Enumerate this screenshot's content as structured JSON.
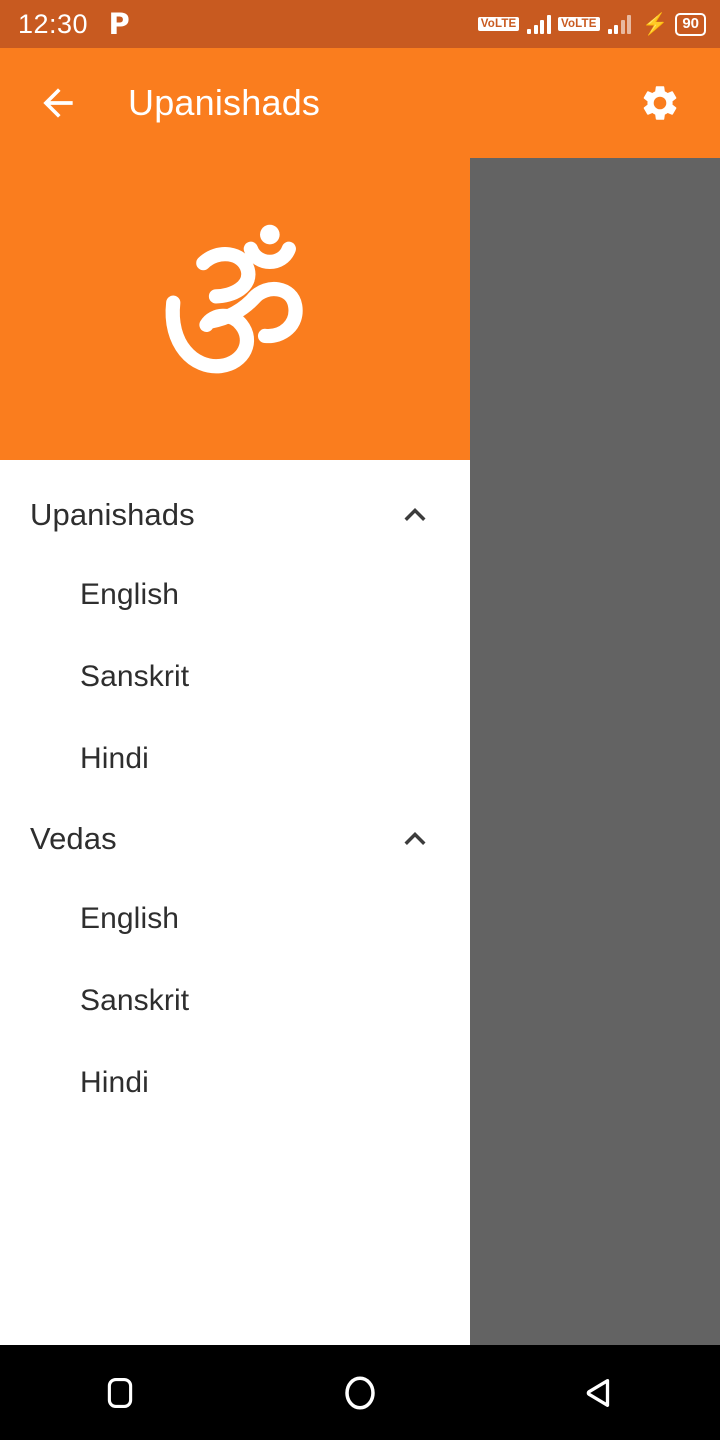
{
  "status_bar": {
    "clock": "12:30",
    "notification_icon": "p-app-icon",
    "sim1_network": "VoLTE",
    "sim2_network": "VoLTE",
    "charging_icon": "charging-bolt-icon",
    "battery_level": "90",
    "background_color": "#c85a20"
  },
  "app_bar": {
    "back_icon": "back-arrow-icon",
    "title": "Upanishads",
    "settings_icon": "gear-icon",
    "background_color": "#fa7d1e"
  },
  "drawer": {
    "header_icon": "om-symbol-icon",
    "header_background_color": "#fa7d1e",
    "groups": [
      {
        "label": "Upanishads",
        "chevron_icon": "chevron-up-icon",
        "expanded": true,
        "items": [
          {
            "label": "English"
          },
          {
            "label": "Sanskrit"
          },
          {
            "label": "Hindi"
          }
        ]
      },
      {
        "label": "Vedas",
        "chevron_icon": "chevron-up-icon",
        "expanded": true,
        "items": [
          {
            "label": "English"
          },
          {
            "label": "Sanskrit"
          },
          {
            "label": "Hindi"
          }
        ]
      }
    ]
  },
  "scrim": {
    "color": "#636363"
  },
  "nav_bar": {
    "recents_icon": "square-recents-icon",
    "home_icon": "circle-home-icon",
    "back_icon": "triangle-back-icon",
    "background_color": "#000000"
  }
}
